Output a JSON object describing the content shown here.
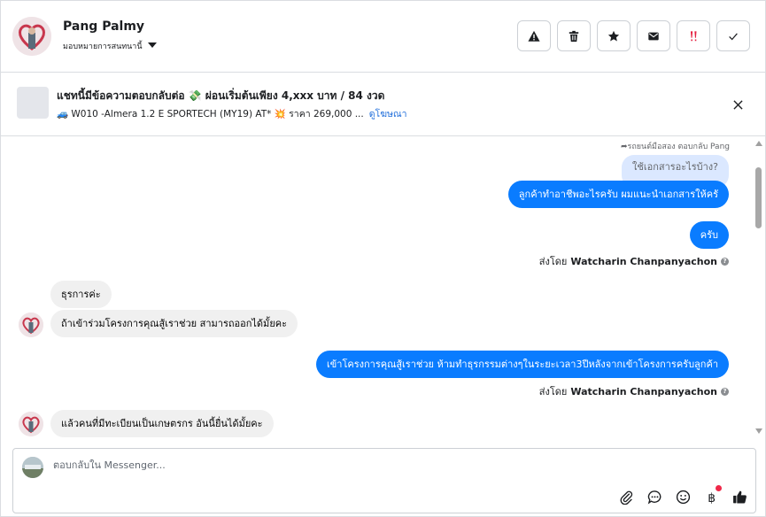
{
  "header": {
    "contact_name": "Pang Palmy",
    "assign_label": "มอบหมายการสนทนานี้",
    "actions": [
      {
        "name": "report-button",
        "icon": "warning-icon"
      },
      {
        "name": "delete-button",
        "icon": "trash-icon"
      },
      {
        "name": "star-button",
        "icon": "star-icon"
      },
      {
        "name": "mark-unread-button",
        "icon": "envelope-icon"
      },
      {
        "name": "follow-up-button",
        "icon": "exclamation-icon"
      },
      {
        "name": "mark-done-button",
        "icon": "check-icon"
      }
    ]
  },
  "ad": {
    "title": "แชทนี้มีข้อความตอบกลับต่อ 💸 ผ่อนเริ่มต้นเพียง 4,xxx บาท / 84 งวด",
    "subtitle": "🚙 W010 -Almera 1.2 E SPORTECH (MY19) AT* 💥 ราคา 269,000 ...",
    "link": "ดูโฆษณา"
  },
  "chat": {
    "reply_note": "รถยนต์มือสอง ตอบกลับ Pang",
    "quoted": "ใช้เอกสารอะไรบ้าง?",
    "messages": [
      {
        "from": "page",
        "text": "ลูกค้าทำอาชีพอะไรครับ ผมแนะนำเอกสารให้ครั"
      },
      {
        "from": "page",
        "text": "ครับ"
      },
      {
        "from": "customer",
        "text": "ธุรการค่ะ"
      },
      {
        "from": "customer",
        "text": "ถ้าเข้าร่วมโครงการคุณสู้เราช่วย สามารถออกได้มั้ยคะ"
      },
      {
        "from": "page",
        "text": "เข้าโครงการคุณสู้เราช่วย ห้ามทำธุรกรรมต่างๆในระยะเวลา3ปีหลังจากเข้าโครงการครับลูกค้า"
      },
      {
        "from": "customer",
        "text": "แล้วคนที่มีทะเบียนเป็นเกษตรกร อันนี้ยื่นได้มั้ยคะ"
      }
    ],
    "sent_by_label": "ส่งโดย",
    "agent_name": "Watcharin Chanpanyachon"
  },
  "composer": {
    "placeholder": "ตอบกลับใน Messenger...",
    "tools": [
      "attach-icon",
      "message-bubble-icon",
      "emoji-icon",
      "baht-icon",
      "thumbs-up-icon"
    ]
  },
  "colors": {
    "outgoing_bubble": "#0a7cff",
    "quoted_bubble": "#dbe8ff",
    "incoming_bubble": "#f0f0f0",
    "link": "#216fdb",
    "alert_red": "#e41e3f"
  }
}
